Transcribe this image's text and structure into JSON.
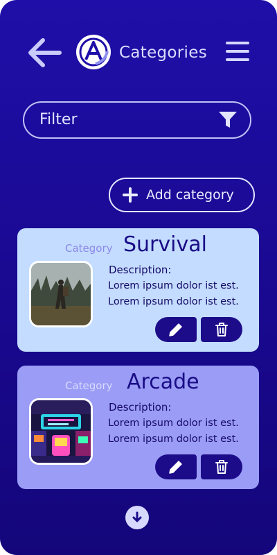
{
  "header": {
    "title": "Categories",
    "back_icon": "arrow-left-icon",
    "logo_icon": "brand-logo",
    "menu_icon": "hamburger-menu-icon"
  },
  "filter": {
    "label": "Filter",
    "icon": "funnel-icon"
  },
  "actions": {
    "add_label": "Add category",
    "add_icon": "plus-icon"
  },
  "categories": [
    {
      "tag": "Category",
      "name": "Survival",
      "description_label": "Description:",
      "description_lines": [
        "Lorem ipsum dolor ist est.",
        "Lorem ipsum dolor ist est."
      ],
      "image": "survival-game-thumbnail",
      "edit_icon": "pencil-icon",
      "delete_icon": "trash-icon"
    },
    {
      "tag": "Category",
      "name": "Arcade",
      "description_label": "Description:",
      "description_lines": [
        "Lorem ipsum dolor ist est.",
        "Lorem ipsum dolor ist est."
      ],
      "image": "arcade-thumbnail",
      "edit_icon": "pencil-icon",
      "delete_icon": "trash-icon"
    }
  ],
  "pagination": {
    "scroll_icon": "arrow-down-circle-icon"
  },
  "colors": {
    "background_top": "#1f0fa8",
    "background_bottom": "#14067a",
    "card_primary": "#c3dcff",
    "card_secondary": "#9a9cf5",
    "accent_dark": "#1c0c8a",
    "text_light": "#dcdcff"
  }
}
